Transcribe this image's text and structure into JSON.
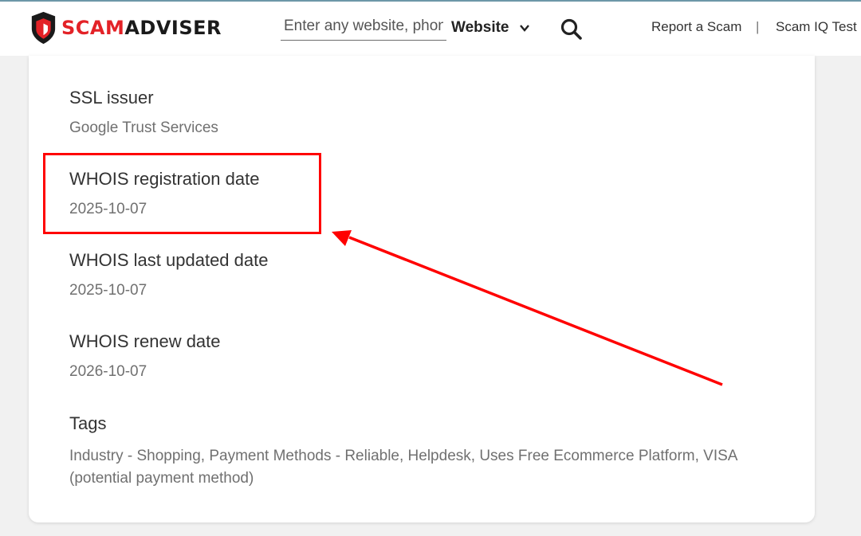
{
  "header": {
    "brand": {
      "part1": "SCAM",
      "part2": "ADVISER"
    },
    "search": {
      "placeholder": "Enter any website, phone number or email"
    },
    "type_select": {
      "selected": "Website"
    },
    "nav": {
      "report_scam": "Report a Scam",
      "separator": "|",
      "scam_iq_test": "Scam IQ Test"
    },
    "colors": {
      "brand_red": "#e32227",
      "highlight_red": "#ff0000"
    }
  },
  "details": [
    {
      "label": "SSL issuer",
      "value": "Google Trust Services"
    },
    {
      "label": "WHOIS registration date",
      "value": "2025-10-07"
    },
    {
      "label": "WHOIS last updated date",
      "value": "2025-10-07"
    },
    {
      "label": "WHOIS renew date",
      "value": "2026-10-07"
    }
  ],
  "tags": {
    "label": "Tags",
    "value": "Industry - Shopping, Payment Methods - Reliable, Helpdesk, Uses Free Ecommerce Platform, VISA (potential payment method)"
  },
  "icons": [
    "shield-logo-icon",
    "chevron-down-icon",
    "search-icon"
  ]
}
